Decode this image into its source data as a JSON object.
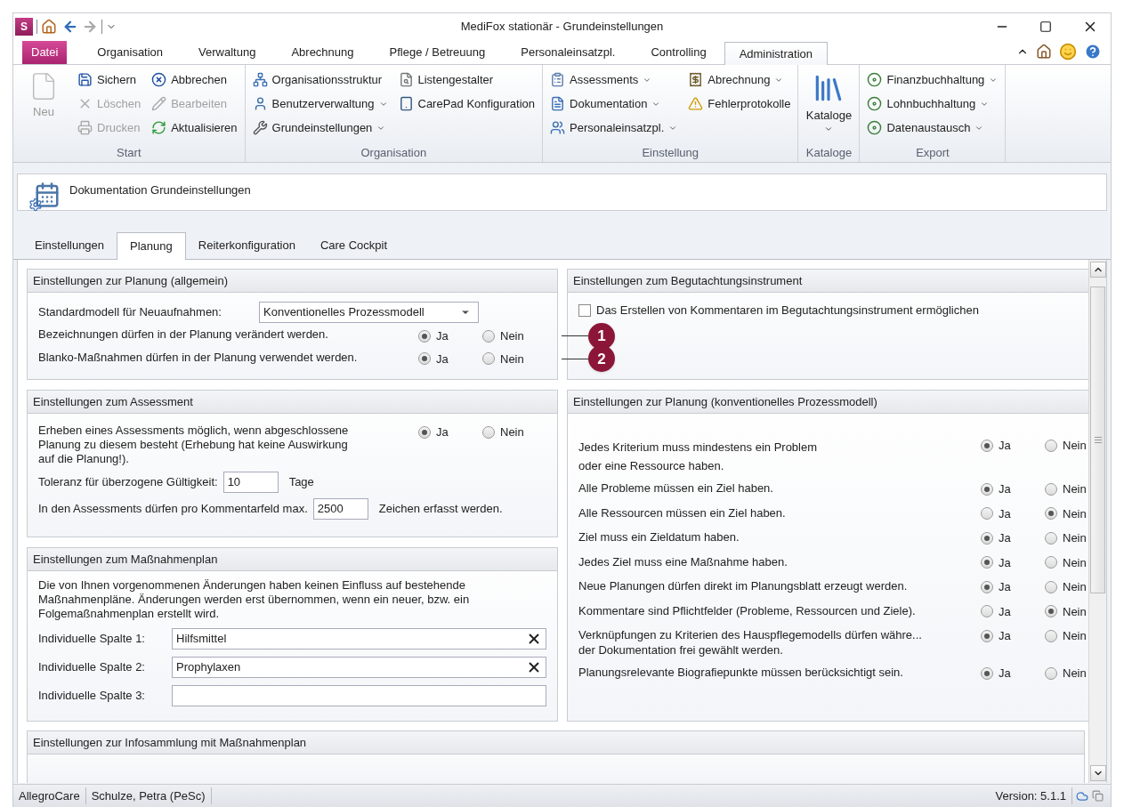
{
  "window": {
    "app_logo": "S",
    "title": "MediFox stationär - Grundeinstellungen"
  },
  "ribbon": {
    "tabs": [
      {
        "label": "Datei",
        "kind": "file"
      },
      {
        "label": "Organisation",
        "kind": "tab",
        "selected": false
      },
      {
        "label": "Verwaltung",
        "kind": "tab",
        "selected": false
      },
      {
        "label": "Abrechnung",
        "kind": "tab",
        "selected": false
      },
      {
        "label": "Pflege / Betreuung",
        "kind": "tab",
        "selected": false
      },
      {
        "label": "Personaleinsatzpl.",
        "kind": "tab",
        "selected": false
      },
      {
        "label": "Controlling",
        "kind": "tab",
        "selected": false
      },
      {
        "label": "Administration",
        "kind": "tab",
        "selected": true
      }
    ],
    "groups": [
      {
        "label": "Start",
        "large": [
          {
            "label": "Neu",
            "disabled": true,
            "dropdown": false
          }
        ],
        "columns": [
          [
            {
              "label": "Sichern",
              "disabled": false,
              "dropdown": false
            },
            {
              "label": "Löschen",
              "disabled": true,
              "dropdown": false
            },
            {
              "label": "Drucken",
              "disabled": true,
              "dropdown": false
            }
          ],
          [
            {
              "label": "Abbrechen",
              "disabled": false,
              "dropdown": false
            },
            {
              "label": "Bearbeiten",
              "disabled": true,
              "dropdown": false
            },
            {
              "label": "Aktualisieren",
              "disabled": false,
              "dropdown": false
            }
          ]
        ]
      },
      {
        "label": "Organisation",
        "columns": [
          [
            {
              "label": "Organisationsstruktur",
              "disabled": false,
              "dropdown": false
            },
            {
              "label": "Benutzerverwaltung",
              "disabled": false,
              "dropdown": true
            },
            {
              "label": "Grundeinstellungen",
              "disabled": false,
              "dropdown": true
            }
          ],
          [
            {
              "label": "Listengestalter",
              "disabled": false,
              "dropdown": false
            },
            {
              "label": "CarePad Konfiguration",
              "disabled": false,
              "dropdown": false
            }
          ]
        ]
      },
      {
        "label": "Einstellung",
        "columns": [
          [
            {
              "label": "Assessments",
              "disabled": false,
              "dropdown": true
            },
            {
              "label": "Dokumentation",
              "disabled": false,
              "dropdown": true
            },
            {
              "label": "Personaleinsatzpl.",
              "disabled": false,
              "dropdown": true
            }
          ],
          [
            {
              "label": "Abrechnung",
              "disabled": false,
              "dropdown": true
            },
            {
              "label": "Fehlerprotokolle",
              "disabled": false,
              "dropdown": false
            }
          ]
        ]
      },
      {
        "label": "Kataloge",
        "large": [
          {
            "label": "Kataloge",
            "disabled": false,
            "dropdown": true
          }
        ]
      },
      {
        "label": "Export",
        "columns": [
          [
            {
              "label": "Finanzbuchhaltung",
              "disabled": false,
              "dropdown": true
            },
            {
              "label": "Lohnbuchhaltung",
              "disabled": false,
              "dropdown": true
            },
            {
              "label": "Datenaustausch",
              "disabled": false,
              "dropdown": true
            }
          ]
        ]
      }
    ]
  },
  "header": {
    "title": "Dokumentation Grundeinstellungen"
  },
  "tabs": [
    {
      "label": "Einstellungen",
      "selected": false
    },
    {
      "label": "Planung",
      "selected": true
    },
    {
      "label": "Reiterkonfiguration",
      "selected": false
    },
    {
      "label": "Care Cockpit",
      "selected": false
    }
  ],
  "left_panels": [
    {
      "title": "Einstellungen zur Planung (allgemein)",
      "rows": [
        {
          "kind": "select",
          "label": "Standardmodell für Neuaufnahmen:",
          "value": "Konventionelles Prozessmodell"
        },
        {
          "kind": "radio",
          "label": "Bezeichnungen dürfen in der Planung verändert werden.",
          "options": [
            {
              "label": "Ja",
              "selected": true
            },
            {
              "label": "Nein",
              "selected": false
            }
          ],
          "callout": "1"
        },
        {
          "kind": "radio",
          "label": "Blanko-Maßnahmen dürfen in der Planung verwendet werden.",
          "options": [
            {
              "label": "Ja",
              "selected": true
            },
            {
              "label": "Nein",
              "selected": false
            }
          ],
          "callout": "2"
        }
      ]
    },
    {
      "title": "Einstellungen zum Assessment",
      "rows": [
        {
          "kind": "radio",
          "label": "Erheben eines Assessments möglich, wenn abgeschlossene Planung zu diesem besteht (Erhebung hat keine Auswirkung auf die Planung!).",
          "options": [
            {
              "label": "Ja",
              "selected": true
            },
            {
              "label": "Nein",
              "selected": false
            }
          ]
        },
        {
          "kind": "number",
          "label": "Toleranz für überzogene Gültigkeit:",
          "value": "10",
          "suffix": "Tage"
        },
        {
          "kind": "number",
          "label": "In den Assessments dürfen pro Kommentarfeld max.",
          "value": "2500",
          "suffix": "Zeichen erfasst werden."
        }
      ]
    },
    {
      "title": "Einstellungen zum Maßnahmenplan",
      "rows": [
        {
          "kind": "note",
          "text": "Die von Ihnen vorgenommenen Änderungen haben keinen Einfluss auf bestehende Maßnahmenpläne. Änderungen werden erst übernommen, wenn ein neuer, bzw. ein Folgemaßnahmenplan erstellt wird."
        },
        {
          "kind": "text",
          "label": "Individuelle Spalte 1:",
          "value": "Hilfsmittel"
        },
        {
          "kind": "text",
          "label": "Individuelle Spalte 2:",
          "value": "Prophylaxen"
        },
        {
          "kind": "text",
          "label": "Individuelle Spalte 3:"
        }
      ]
    }
  ],
  "right_panels": [
    {
      "title": "Einstellungen zum Begutachtungsinstrument",
      "rows": [
        {
          "kind": "checkbox",
          "label": "Das Erstellen von Kommentaren im Begutachtungsinstrument ermöglichen",
          "checked": false
        }
      ]
    },
    {
      "title": "Einstellungen zur Planung (konventionelles Prozessmodell)",
      "rows": [
        {
          "kind": "radio",
          "lines": [
            "Jedes Kriterium muss mindestens ein Problem",
            "oder eine Ressource haben."
          ],
          "options": [
            {
              "label": "Ja",
              "selected": true
            },
            {
              "label": "Nein",
              "selected": false
            }
          ]
        },
        {
          "kind": "radio",
          "lines": [
            "Alle Probleme müssen ein Ziel haben."
          ],
          "options": [
            {
              "label": "Ja",
              "selected": true
            },
            {
              "label": "Nein",
              "selected": false
            }
          ]
        },
        {
          "kind": "radio",
          "lines": [
            "Alle Ressourcen müssen ein Ziel haben."
          ],
          "options": [
            {
              "label": "Ja",
              "selected": false
            },
            {
              "label": "Nein",
              "selected": true
            }
          ]
        },
        {
          "kind": "radio",
          "lines": [
            "Ziel muss ein Zieldatum haben."
          ],
          "options": [
            {
              "label": "Ja",
              "selected": true
            },
            {
              "label": "Nein",
              "selected": false
            }
          ]
        },
        {
          "kind": "radio",
          "lines": [
            "Jedes Ziel muss eine Maßnahme haben."
          ],
          "options": [
            {
              "label": "Ja",
              "selected": true
            },
            {
              "label": "Nein",
              "selected": false
            }
          ]
        },
        {
          "kind": "radio",
          "lines": [
            "Neue Planungen dürfen direkt im Planungsblatt erzeugt werden."
          ],
          "options": [
            {
              "label": "Ja",
              "selected": true
            },
            {
              "label": "Nein",
              "selected": false
            }
          ]
        },
        {
          "kind": "radio",
          "lines": [
            "Kommentare sind Pflichtfelder (Probleme, Ressourcen und Ziele)."
          ],
          "options": [
            {
              "label": "Ja",
              "selected": false
            },
            {
              "label": "Nein",
              "selected": true
            }
          ]
        },
        {
          "kind": "radio",
          "lines": [
            "Verknüpfungen zu Kriterien des Hauspflegemodells dürfen währe...",
            "der Dokumentation frei gewählt werden."
          ],
          "options": [
            {
              "label": "Ja",
              "selected": true
            },
            {
              "label": "Nein",
              "selected": false
            }
          ]
        },
        {
          "kind": "radio",
          "lines": [
            "Planungsrelevante Biografiepunkte müssen berücksichtigt sein."
          ],
          "options": [
            {
              "label": "Ja",
              "selected": true
            },
            {
              "label": "Nein",
              "selected": false
            }
          ]
        }
      ]
    }
  ],
  "bottom_panel": {
    "title": "Einstellungen zur Infosammlung mit Maßnahmenplan"
  },
  "status_bar": {
    "items": [
      "AllegroCare",
      "Schulze, Petra (PeSc)"
    ],
    "version": "Version: 5.1.1"
  }
}
